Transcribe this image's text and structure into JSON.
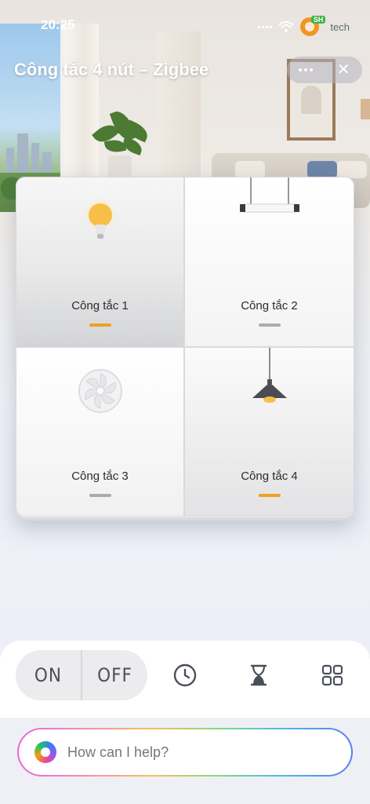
{
  "status": {
    "time": "20:25",
    "brand_tag": "SH",
    "brand": "tech"
  },
  "header": {
    "title": "Công tắc 4 nút – Zigbee"
  },
  "switches": [
    {
      "label": "Công tắc 1",
      "icon": "lightbulb-icon",
      "state": "on"
    },
    {
      "label": "Công tắc 2",
      "icon": "linear-pendant-light-icon",
      "state": "off"
    },
    {
      "label": "Công tắc 3",
      "icon": "ceiling-fan-icon",
      "state": "off"
    },
    {
      "label": "Công tắc 4",
      "icon": "pendant-lamp-icon",
      "state": "on"
    }
  ],
  "colors": {
    "on": "#f0a023",
    "off": "#a9acb2"
  },
  "controls": {
    "on_label": "ON",
    "off_label": "OFF",
    "icons": [
      "clock-icon",
      "hourglass-icon",
      "grid-icon"
    ]
  },
  "assistant": {
    "placeholder": "How can I help?"
  }
}
